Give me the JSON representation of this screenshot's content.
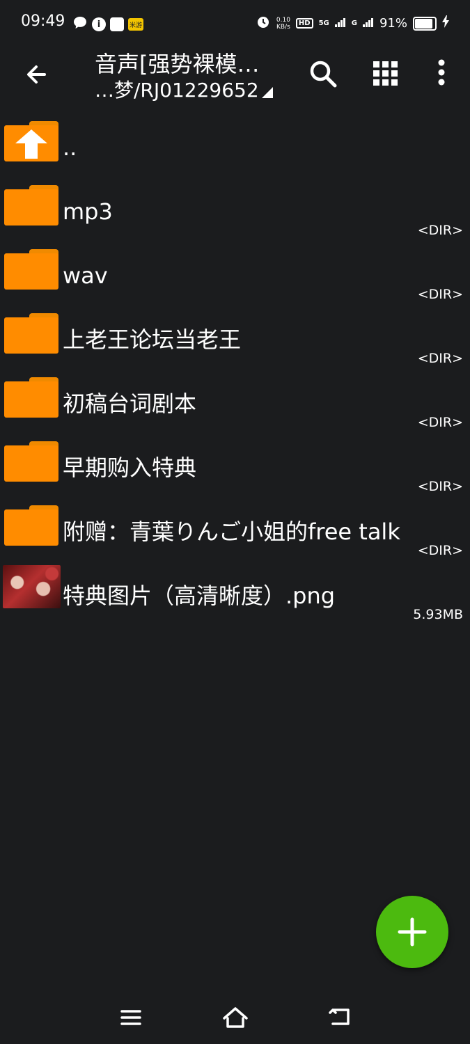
{
  "status_bar": {
    "time": "09:49",
    "net_speed_value": "0.10",
    "net_speed_unit": "KB/s",
    "hd_label": "HD",
    "signal_5g": "5G",
    "signal_g": "G",
    "battery_percent": "91%",
    "battery_level": 0.91,
    "info_icon": "i",
    "mi_label": "米游"
  },
  "toolbar": {
    "title": "音声[强势裸模…",
    "subtitle": "…梦/RJ01229652"
  },
  "files": [
    {
      "name": "..",
      "meta": "",
      "type": "parent-folder"
    },
    {
      "name": "mp3",
      "meta": "<DIR>",
      "type": "folder"
    },
    {
      "name": "wav",
      "meta": "<DIR>",
      "type": "folder"
    },
    {
      "name": "上老王论坛当老王",
      "meta": "<DIR>",
      "type": "folder"
    },
    {
      "name": "初稿台词剧本",
      "meta": "<DIR>",
      "type": "folder"
    },
    {
      "name": "早期购入特典",
      "meta": "<DIR>",
      "type": "folder"
    },
    {
      "name": "附赠：青葉りんご小姐的free talk",
      "meta": "<DIR>",
      "type": "folder"
    },
    {
      "name": "特典图片（高清晰度）.png",
      "meta": "5.93MB",
      "type": "image"
    }
  ],
  "colors": {
    "background": "#1b1c1e",
    "folder": "#ff8c00",
    "fab": "#4cba0f"
  }
}
